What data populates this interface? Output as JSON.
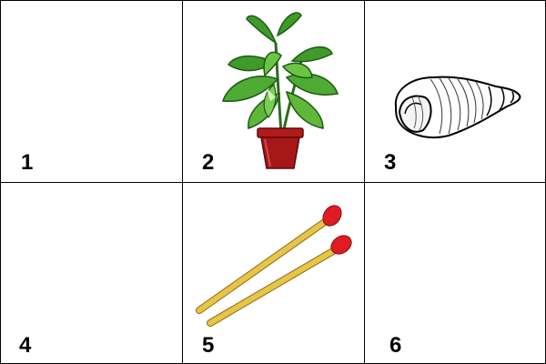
{
  "cells": [
    {
      "label": "1",
      "content": ""
    },
    {
      "label": "2",
      "content": "plant-icon"
    },
    {
      "label": "3",
      "content": "seashell-icon"
    },
    {
      "label": "4",
      "content": ""
    },
    {
      "label": "5",
      "content": "matches-icon"
    },
    {
      "label": "6",
      "content": ""
    }
  ],
  "colors": {
    "leaf_dark": "#2e7d1f",
    "leaf_light": "#5fb83a",
    "pot": "#b31b1b",
    "match_stick": "#e8c547",
    "match_head": "#e01b24"
  }
}
